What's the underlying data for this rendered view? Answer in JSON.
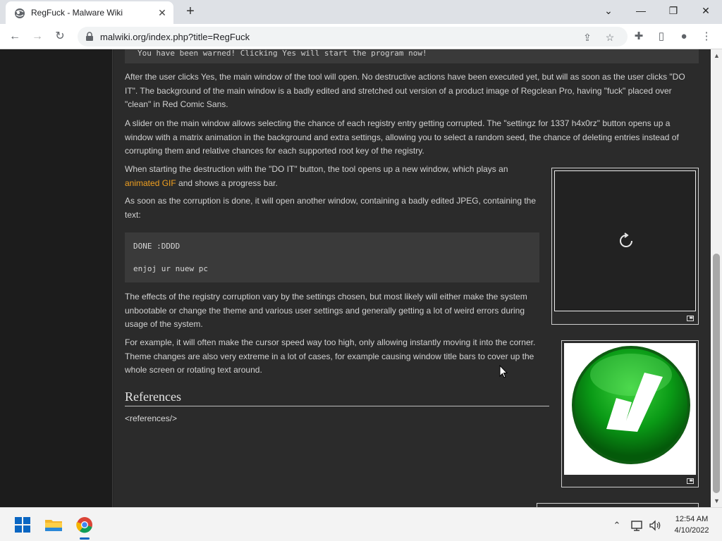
{
  "browser": {
    "tab_title": "RegFuck - Malware Wiki",
    "tab_close": "✕",
    "new_tab": "+",
    "url": "malwiki.org/index.php?title=RegFuck",
    "win_chevron": "⌄",
    "win_min": "—",
    "win_max": "❐",
    "win_close": "✕",
    "back": "←",
    "forward": "→",
    "reload": "↻",
    "share": "⇪",
    "star": "☆",
    "extensions": "✚",
    "sidepanel": "▯",
    "profile": "●",
    "menu": "⋮"
  },
  "article": {
    "top_code": "You have been warned! Clicking Yes will start the program now!",
    "p1": "After the user clicks Yes, the main window of the tool will open. No destructive actions have been executed yet, but will as soon as the user clicks \"DO IT\". The background of the main window is a badly edited and stretched out version of a product image of Regclean Pro, having \"fuck\" placed over \"clean\" in Red Comic Sans.",
    "p2": "A slider on the main window allows selecting the chance of each registry entry getting corrupted. The \"settingz for 1337 h4x0rz\" button opens up a window with a matrix animation in the background and extra settings, allowing you to select a random seed, the chance of deleting entries instead of corrupting them and relative chances for each supported root key of the registry.",
    "p3_before": "When starting the destruction with the \"DO IT\" button, the tool opens up a new window, which plays an",
    "p3_link": "animated GIF",
    "p3_after": " and shows a progress bar.",
    "p4": "As soon as the corruption is done, it will open another window, containing a badly edited JPEG, containing the text:",
    "code_line1": "DONE :DDDD",
    "code_line2": "enjoj ur nuew pc",
    "p5": "The effects of the registry corruption vary by the settings chosen, but most likely will either make the system unbootable or change the theme and various user settings and generally getting a lot of weird errors during usage of the system.",
    "p6": "For example, it will often make the cursor speed way too high, only allowing instantly moving it into the corner. Theme changes are also very extreme in a lot of cases, for example causing window title bars to cover up the whole screen or rotating text around.",
    "references_heading": "References",
    "references_raw": "<references/>"
  },
  "scrollbar": {
    "up": "▲",
    "down": "▼"
  },
  "taskbar": {
    "tray_chevron": "⌃",
    "time": "12:54 AM",
    "date": "4/10/2022"
  },
  "colors": {
    "link": "#f0a020",
    "page_bg": "#2b2b2b",
    "accent": "#0a66c2"
  }
}
